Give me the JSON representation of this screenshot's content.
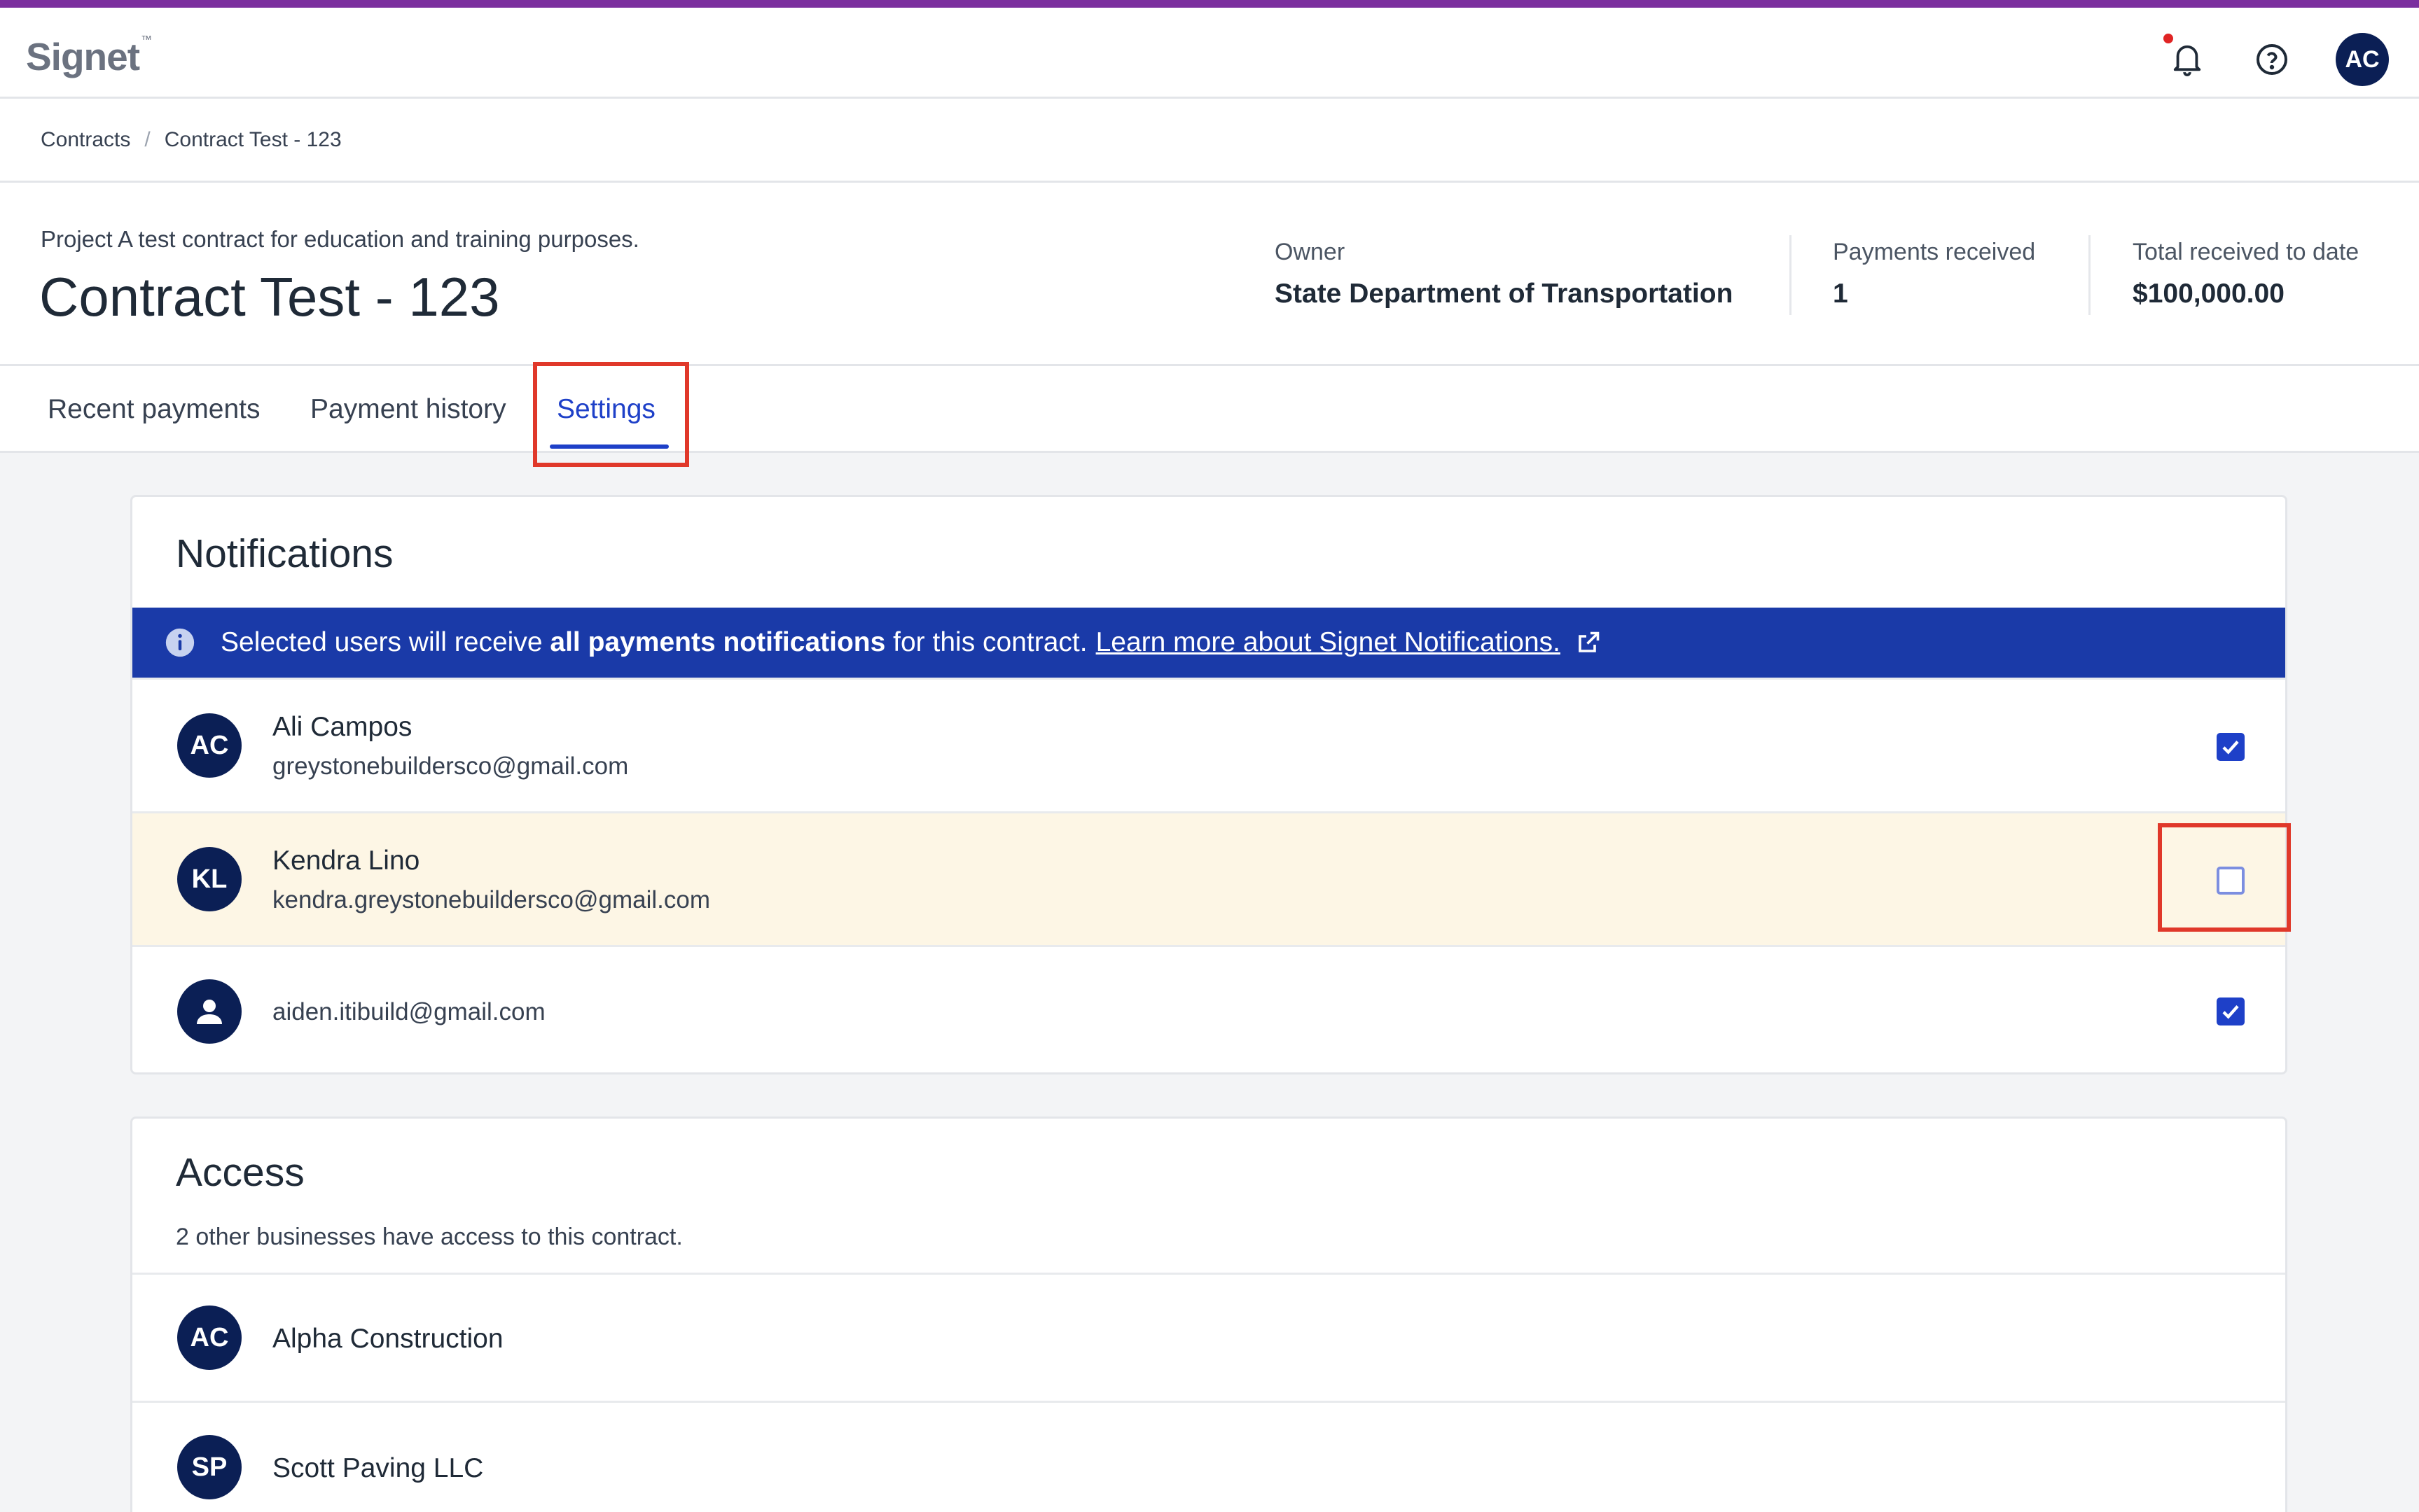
{
  "app": {
    "logo": "Signet",
    "logo_mark": "™"
  },
  "topbar": {
    "avatar_initials": "AC",
    "icons": [
      "bell-icon",
      "help-circle-icon"
    ]
  },
  "breadcrumb": {
    "items": [
      "Contracts",
      "Contract Test - 123"
    ],
    "separator": "/"
  },
  "header": {
    "description": "Project A test contract for education and training purposes.",
    "title": "Contract Test - 123",
    "owner_label": "Owner",
    "owner_value": "State Department of Transportation",
    "payments_label": "Payments received",
    "payments_value": "1",
    "total_label": "Total received to date",
    "total_value": "$100,000.00"
  },
  "tabs": [
    {
      "label": "Recent payments",
      "active": false
    },
    {
      "label": "Payment history",
      "active": false
    },
    {
      "label": "Settings",
      "active": true
    }
  ],
  "notifications": {
    "title": "Notifications",
    "banner": {
      "prefix": "Selected users will receive",
      "bold": "all payments notifications",
      "suffix": "for this contract.",
      "link": "Learn more about Signet Notifications."
    },
    "users": [
      {
        "initials": "AC",
        "name": "Ali Campos",
        "email": "greystonebuildersco@gmail.com",
        "checked": true
      },
      {
        "initials": "KL",
        "name": "Kendra Lino",
        "email": "kendra.greystonebuildersco@gmail.com",
        "checked": false
      },
      {
        "initials": "",
        "name": "",
        "email": "aiden.itibuild@gmail.com",
        "checked": true
      }
    ]
  },
  "access": {
    "title": "Access",
    "subtitle": "2 other businesses have access to this contract.",
    "businesses": [
      {
        "initials": "AC",
        "name": "Alpha Construction"
      },
      {
        "initials": "SP",
        "name": "Scott Paving LLC"
      }
    ]
  },
  "colors": {
    "accent": "#1e40c8",
    "navy": "#0b1f55",
    "banner": "#1a3aa8",
    "highlight_box": "#e0382a",
    "top_stripe": "#7b2f9e"
  }
}
